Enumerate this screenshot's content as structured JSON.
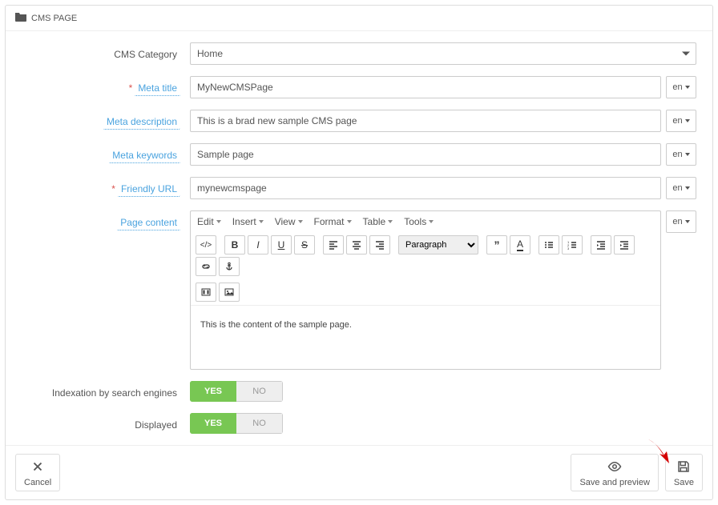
{
  "header": {
    "title": "CMS PAGE"
  },
  "labels": {
    "cms_category": "CMS Category",
    "meta_title": "Meta title",
    "meta_description": "Meta description",
    "meta_keywords": "Meta keywords",
    "friendly_url": "Friendly URL",
    "page_content": "Page content",
    "indexation": "Indexation by search engines",
    "displayed": "Displayed"
  },
  "fields": {
    "cms_category": "Home",
    "meta_title": "MyNewCMSPage",
    "meta_description": "This is a brad new sample CMS page",
    "meta_keywords": "Sample page",
    "friendly_url": "mynewcmspage",
    "page_content_body": "This is the content of the sample page."
  },
  "lang": "en",
  "editor": {
    "menu": [
      "Edit",
      "Insert",
      "View",
      "Format",
      "Table",
      "Tools"
    ],
    "paragraph": "Paragraph"
  },
  "toggle": {
    "yes": "YES",
    "no": "NO"
  },
  "footer": {
    "cancel": "Cancel",
    "save_preview": "Save and preview",
    "save": "Save"
  }
}
